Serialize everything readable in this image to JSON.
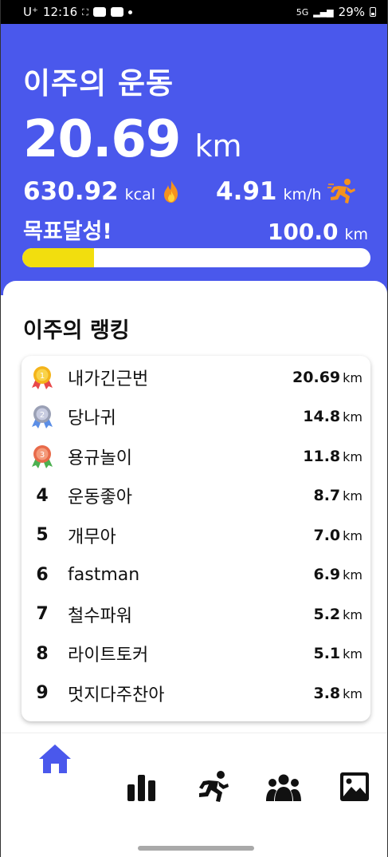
{
  "status_bar": {
    "carrier": "U⁺",
    "time": "12:16",
    "battery": "29%"
  },
  "summary": {
    "title": "이주의 운동",
    "distance_value": "20.69",
    "distance_unit": "km",
    "calories_value": "630.92",
    "calories_unit": "kcal",
    "speed_value": "4.91",
    "speed_unit": "km/h",
    "goal_label": "목표달성!",
    "goal_value": "100.0",
    "goal_unit": "km",
    "progress_fraction": 0.2069
  },
  "ranking": {
    "title": "이주의 랭킹",
    "unit": "km",
    "rows": [
      {
        "rank": "1",
        "medal": "gold",
        "name": "내가긴근번",
        "distance": "20.69"
      },
      {
        "rank": "2",
        "medal": "silver",
        "name": "당나귀",
        "distance": "14.8"
      },
      {
        "rank": "3",
        "medal": "bronze",
        "name": "용규놀이",
        "distance": "11.8"
      },
      {
        "rank": "4",
        "name": "운동좋아",
        "distance": "8.7"
      },
      {
        "rank": "5",
        "name": "개무아",
        "distance": "7.0"
      },
      {
        "rank": "6",
        "name": "fastman",
        "distance": "6.9"
      },
      {
        "rank": "7",
        "name": "철수파워",
        "distance": "5.2"
      },
      {
        "rank": "8",
        "name": "라이트토커",
        "distance": "5.1"
      },
      {
        "rank": "9",
        "name": "멋지다주찬아",
        "distance": "3.8"
      }
    ]
  },
  "nav": {
    "items": [
      {
        "icon": "home-icon",
        "active": true
      },
      {
        "icon": "bar-chart-icon",
        "active": false
      },
      {
        "icon": "running-icon",
        "active": false
      },
      {
        "icon": "group-icon",
        "active": false
      },
      {
        "icon": "image-icon",
        "active": false
      }
    ],
    "active_color": "#4a58ec"
  },
  "colors": {
    "header_bg": "#4a58ec",
    "progress_fill": "#f2de0e",
    "icon_dark": "#111111"
  }
}
